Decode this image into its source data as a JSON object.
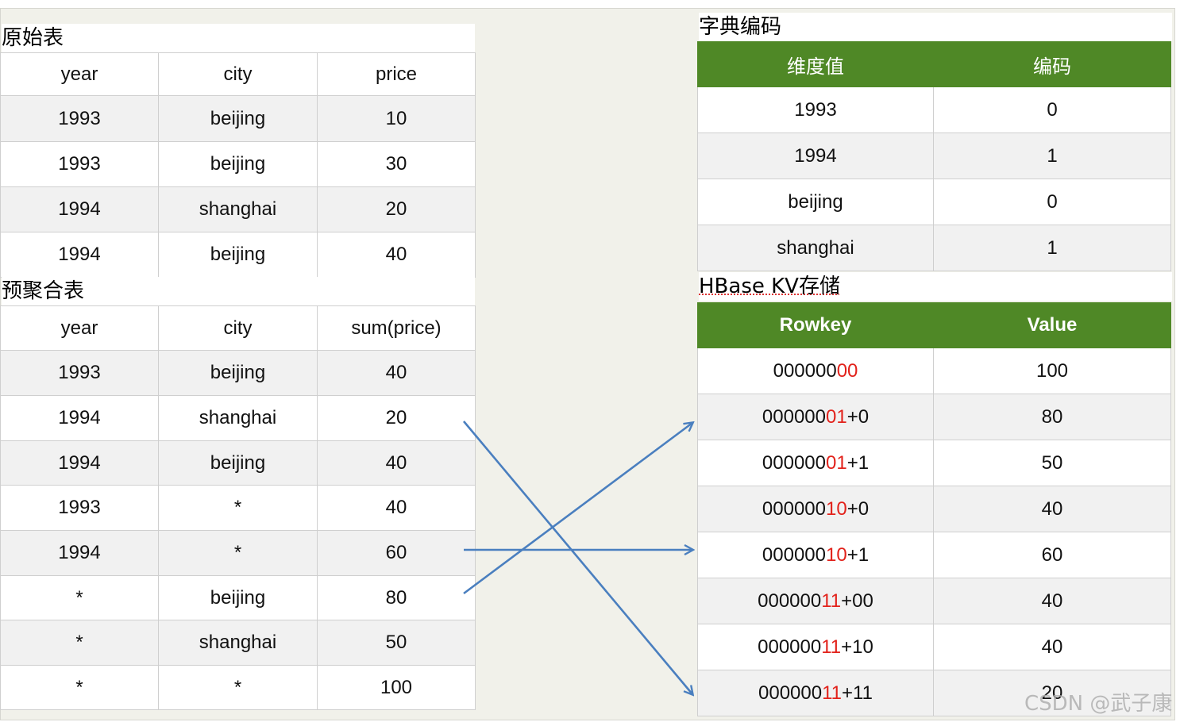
{
  "original_table": {
    "title": "原始表",
    "headers": [
      "year",
      "city",
      "price"
    ],
    "rows": [
      [
        "1993",
        "beijing",
        "10"
      ],
      [
        "1993",
        "beijing",
        "30"
      ],
      [
        "1994",
        "shanghai",
        "20"
      ],
      [
        "1994",
        "beijing",
        "40"
      ]
    ]
  },
  "agg_table": {
    "title": "预聚合表",
    "headers": [
      "year",
      "city",
      "sum(price)"
    ],
    "rows": [
      [
        "1993",
        "beijing",
        "40"
      ],
      [
        "1994",
        "shanghai",
        "20"
      ],
      [
        "1994",
        "beijing",
        "40"
      ],
      [
        "1993",
        "*",
        "40"
      ],
      [
        "1994",
        "*",
        "60"
      ],
      [
        "*",
        "beijing",
        "80"
      ],
      [
        "*",
        "shanghai",
        "50"
      ],
      [
        "*",
        "*",
        "100"
      ]
    ]
  },
  "dict_table": {
    "title": "字典编码",
    "headers": [
      "维度值",
      "编码"
    ],
    "rows": [
      [
        "1993",
        "0"
      ],
      [
        "1994",
        "1"
      ],
      [
        "beijing",
        "0"
      ],
      [
        "shanghai",
        "1"
      ]
    ]
  },
  "kv_table": {
    "title": "HBase KV存储",
    "headers": [
      "Rowkey",
      "Value"
    ],
    "rows": [
      {
        "prefix": "000000",
        "bits": "00",
        "suffix": "",
        "value": "100"
      },
      {
        "prefix": "000000",
        "bits": "01",
        "suffix": "+0",
        "value": "80"
      },
      {
        "prefix": "000000",
        "bits": "01",
        "suffix": "+1",
        "value": "50"
      },
      {
        "prefix": "000000",
        "bits": "10",
        "suffix": "+0",
        "value": "40"
      },
      {
        "prefix": "000000",
        "bits": "10",
        "suffix": "+1",
        "value": "60"
      },
      {
        "prefix": "000000",
        "bits": "11",
        "suffix": "+00",
        "value": "40"
      },
      {
        "prefix": "000000",
        "bits": "11",
        "suffix": "+10",
        "value": "40"
      },
      {
        "prefix": "000000",
        "bits": "11",
        "suffix": "+11",
        "value": "20"
      }
    ]
  },
  "watermark": "CSDN @武子康",
  "colors": {
    "header_green": "#4f8826",
    "bits_red": "#e2221b",
    "arrow_blue": "#4a7fbf"
  }
}
